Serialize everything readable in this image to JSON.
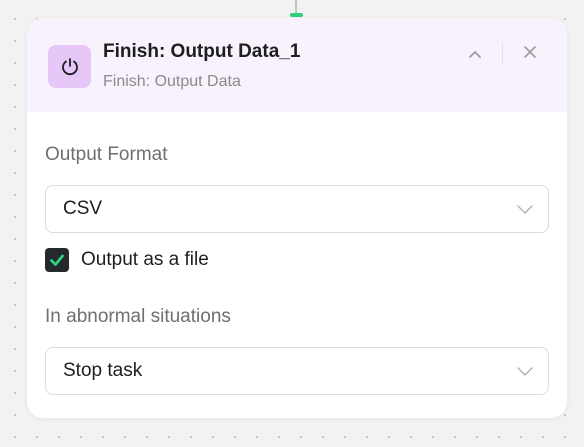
{
  "node": {
    "title": "Finish: Output Data_1",
    "subtitle": "Finish: Output Data",
    "icon": "power-icon"
  },
  "output_format": {
    "label": "Output Format",
    "selected": "CSV"
  },
  "output_as_file": {
    "label": "Output as a file",
    "checked": true
  },
  "abnormal": {
    "label": "In abnormal situations",
    "selected": "Stop task"
  },
  "colors": {
    "accent_green": "#2fd17c",
    "header_bg": "#f8f2fd",
    "icon_bg": "#e6c7f7",
    "checkbox_bg": "#24292e"
  }
}
